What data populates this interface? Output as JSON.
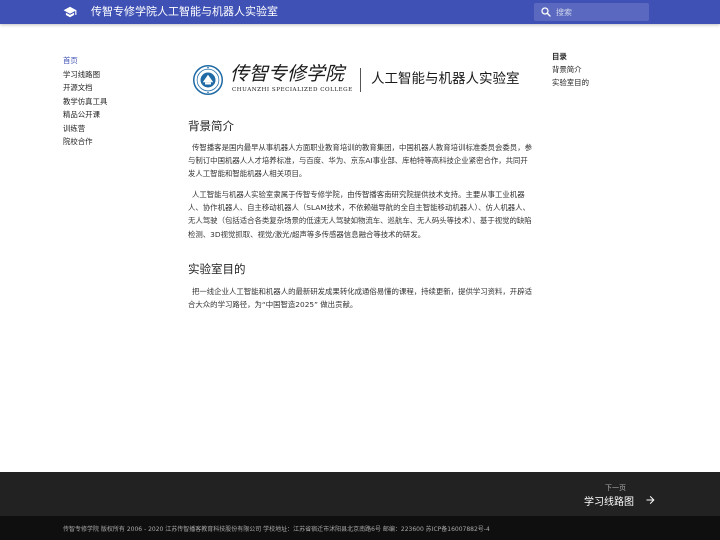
{
  "header": {
    "title": "传智专修学院人工智能与机器人实验室",
    "logo_icon": "graduation-cap-icon",
    "search_placeholder": "搜索",
    "search_icon": "search-icon",
    "colors": {
      "primary": "#3f51b5"
    }
  },
  "sidebar": {
    "items": [
      {
        "label": "首页",
        "active": true
      },
      {
        "label": "学习线路图",
        "active": false
      },
      {
        "label": "开源文档",
        "active": false
      },
      {
        "label": "教学仿真工具",
        "active": false
      },
      {
        "label": "精品公开课",
        "active": false
      },
      {
        "label": "训练营",
        "active": false
      },
      {
        "label": "院校合作",
        "active": false
      }
    ]
  },
  "toc": {
    "title": "目录",
    "items": [
      "背景简介",
      "实验室目的"
    ]
  },
  "banner": {
    "brand_cn": "传智专修学院",
    "brand_en": "CHUANZHI SPECIALIZED COLLEGE",
    "lab_name": "人工智能与机器人实验室"
  },
  "content": {
    "section1_title": "背景简介",
    "section1_p1": "传智播客是国内最早从事机器人方面职业教育培训的教育集团，中国机器人教育培训标准委员会委员，参与制订中国机器人人才培养标准，与百度、华为、京东AI事业部、库柏特等高科技企业紧密合作，共同开发人工智能和智能机器人相关项目。",
    "section1_p2": "人工智能与机器人实验室隶属于传智专修学院，由传智播客南研究院提供技术支持。主要从事工业机器人、协作机器人、自主移动机器人（SLAM技术，不依赖磁导航的全自主智能移动机器人）、仿人机器人、无人驾驶（包括适合各类复杂场景的低速无人驾驶如物流车、巡航车、无人码头等技术）、基于视觉的缺陷检测、3D视觉抓取、视觉/激光/超声等多传感器信息融合等技术的研发。",
    "section2_title": "实验室目的",
    "section2_p1": "把一线企业人工智能和机器人的最新研发成果转化成通俗易懂的课程，持续更新，提供学习资料，开辟适合大众的学习路径，为“中国智造2025” 做出贡献。"
  },
  "footer": {
    "next_caption": "下一页",
    "next_title": "学习线路图",
    "next_icon": "arrow-right-icon",
    "copyright": "传智专修学院 版权所有 2006 - 2020 江苏传智播客教育科技股份有限公司 学校地址：江苏省宿迁市沭阳县北京南路6号 邮编：223600 苏ICP备16007882号-4"
  }
}
